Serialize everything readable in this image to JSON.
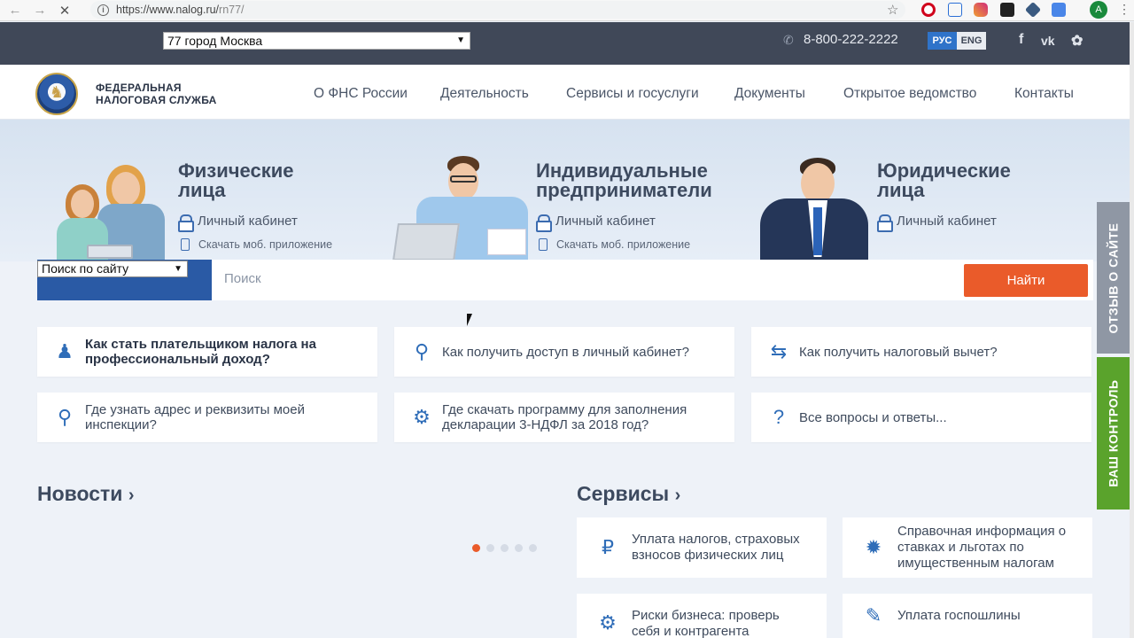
{
  "browser": {
    "url_host": "https://www.nalog.ru/",
    "url_path": "rn77/",
    "back_icon": "arrow-left-icon",
    "forward_icon": "arrow-right-icon",
    "close_icon": "close-icon",
    "avatar_letter": "A"
  },
  "topbar": {
    "region": "77 город Москва",
    "phone": "8-800-222-2222",
    "lang_ru": "РУС",
    "lang_en": "ENG",
    "social": [
      "f",
      "vk",
      "twitter"
    ]
  },
  "header": {
    "org_line1": "ФЕДЕРАЛЬНАЯ",
    "org_line2": "НАЛОГОВАЯ СЛУЖБА",
    "nav": [
      "О ФНС России",
      "Деятельность",
      "Сервисы и госуслуги",
      "Документы",
      "Открытое ведомство",
      "Контакты"
    ]
  },
  "hero": {
    "sections": [
      {
        "title1": "Физические",
        "title2": "лица",
        "cabinet": "Личный кабинет",
        "app": "Скачать моб. приложение"
      },
      {
        "title1": "Индивидуальные",
        "title2": "предприниматели",
        "cabinet": "Личный кабинет",
        "app": "Скачать моб. приложение"
      },
      {
        "title1": "Юридические",
        "title2": "лица",
        "cabinet": "Личный кабинет"
      }
    ]
  },
  "search": {
    "scope": "Поиск по сайту",
    "placeholder": "Поиск",
    "button": "Найти"
  },
  "questions": [
    {
      "l1": "Как стать плательщиком налога на",
      "l2": "профессиональный доход?"
    },
    {
      "l1": "Как получить доступ в личный кабинет?"
    },
    {
      "l1": "Как получить налоговый вычет?"
    },
    {
      "l1": "Где узнать адрес и реквизиты моей",
      "l2": "инспекции?"
    },
    {
      "l1": "Где скачать программу для заполнения",
      "l2": "декларации 3-НДФЛ за 2018 год?"
    },
    {
      "l1": "Все вопросы и ответы..."
    }
  ],
  "news": {
    "title": "Новости",
    "slider_pages": 5,
    "active_page": 1
  },
  "services": {
    "title": "Сервисы",
    "items": [
      {
        "l1": "Уплата налогов, страховых",
        "l2": "взносов физических лиц"
      },
      {
        "l1": "Справочная информация о",
        "l2": "ставках и льготах по",
        "l3": "имущественным налогам"
      },
      {
        "l1": "Риски бизнеса: проверь",
        "l2": "себя и контрагента"
      },
      {
        "l1": "Уплата госпошлины"
      }
    ]
  },
  "side_tabs": {
    "feedback": "ОТЗЫВ О САЙТЕ",
    "control": "ВАШ КОНТРОЛЬ"
  },
  "colors": {
    "accent": "#ea5b2a",
    "brand_blue": "#2a5aa5",
    "topbar": "#404858",
    "green_tab": "#5aa32c",
    "gray_tab": "#8f97a4"
  }
}
